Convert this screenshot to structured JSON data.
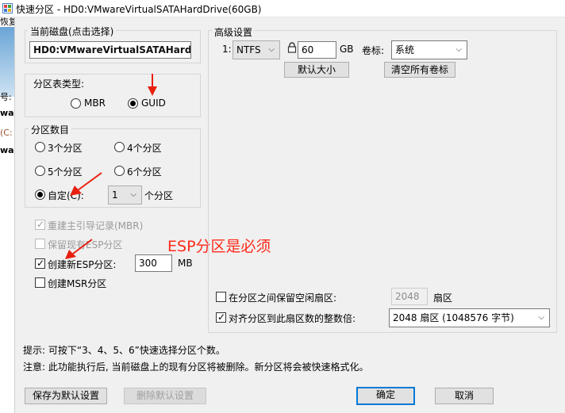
{
  "window": {
    "title": "快速分区 - HD0:VMwareVirtualSATAHardDrive(60GB)"
  },
  "left_strip": {
    "lines": [
      "恢复",
      "号:",
      "ware",
      "(C:",
      "ware"
    ]
  },
  "current_disk": {
    "legend": "当前磁盘(点击选择)",
    "value": "HD0:VMwareVirtualSATAHardl"
  },
  "partition_type": {
    "label": "分区表类型:",
    "options": [
      {
        "label": "MBR",
        "selected": false
      },
      {
        "label": "GUID",
        "selected": true
      }
    ]
  },
  "partition_count": {
    "legend": "分区数目",
    "options": [
      {
        "label": "3个分区",
        "selected": false
      },
      {
        "label": "4个分区",
        "selected": false
      },
      {
        "label": "5个分区",
        "selected": false
      },
      {
        "label": "6个分区",
        "selected": false
      },
      {
        "label": "自定(C):",
        "selected": true
      }
    ],
    "custom_value": "1",
    "custom_suffix": "个分区"
  },
  "options": {
    "rebuild_mbr": {
      "label": "重建主引导记录(MBR)",
      "checked": true,
      "enabled": false
    },
    "keep_esp": {
      "label": "保留现有ESP分区",
      "checked": false,
      "enabled": false
    },
    "create_esp": {
      "label": "创建新ESP分区:",
      "checked": true,
      "enabled": true,
      "size": "300",
      "unit": "MB"
    },
    "create_msr": {
      "label": "创建MSR分区",
      "checked": false,
      "enabled": true
    }
  },
  "annotation": {
    "text": "ESP分区是必须",
    "color": "#ff2a1a"
  },
  "advanced": {
    "legend": "高级设置",
    "row_index": "1:",
    "filesystem": "NTFS",
    "size": "60",
    "size_unit": "GB",
    "volume_label_caption": "卷标:",
    "volume_label": "系统",
    "default_size_button": "默认大小",
    "clear_labels_button": "清空所有卷标"
  },
  "alignment": {
    "keep_free": {
      "label": "在分区之间保留空闲扇区:",
      "checked": false,
      "value": "2048",
      "unit": "扇区"
    },
    "align": {
      "label": "对齐分区到此扇区数的整数倍:",
      "checked": true,
      "value": "2048 扇区 (1048576 字节)"
    }
  },
  "hints": {
    "line1": "提示: 可按下“3、4、5、6”快速选择分区个数。",
    "line2": "注意: 此功能执行后, 当前磁盘上的现有分区将被删除。新分区将会被快速格式化。"
  },
  "buttons": {
    "save_default": "保存为默认设置",
    "delete_default": "删除默认设置",
    "ok": "确定",
    "cancel": "取消"
  },
  "colors": {
    "accent": "#0078d7",
    "dialog_bg": "#f0f0f0"
  }
}
